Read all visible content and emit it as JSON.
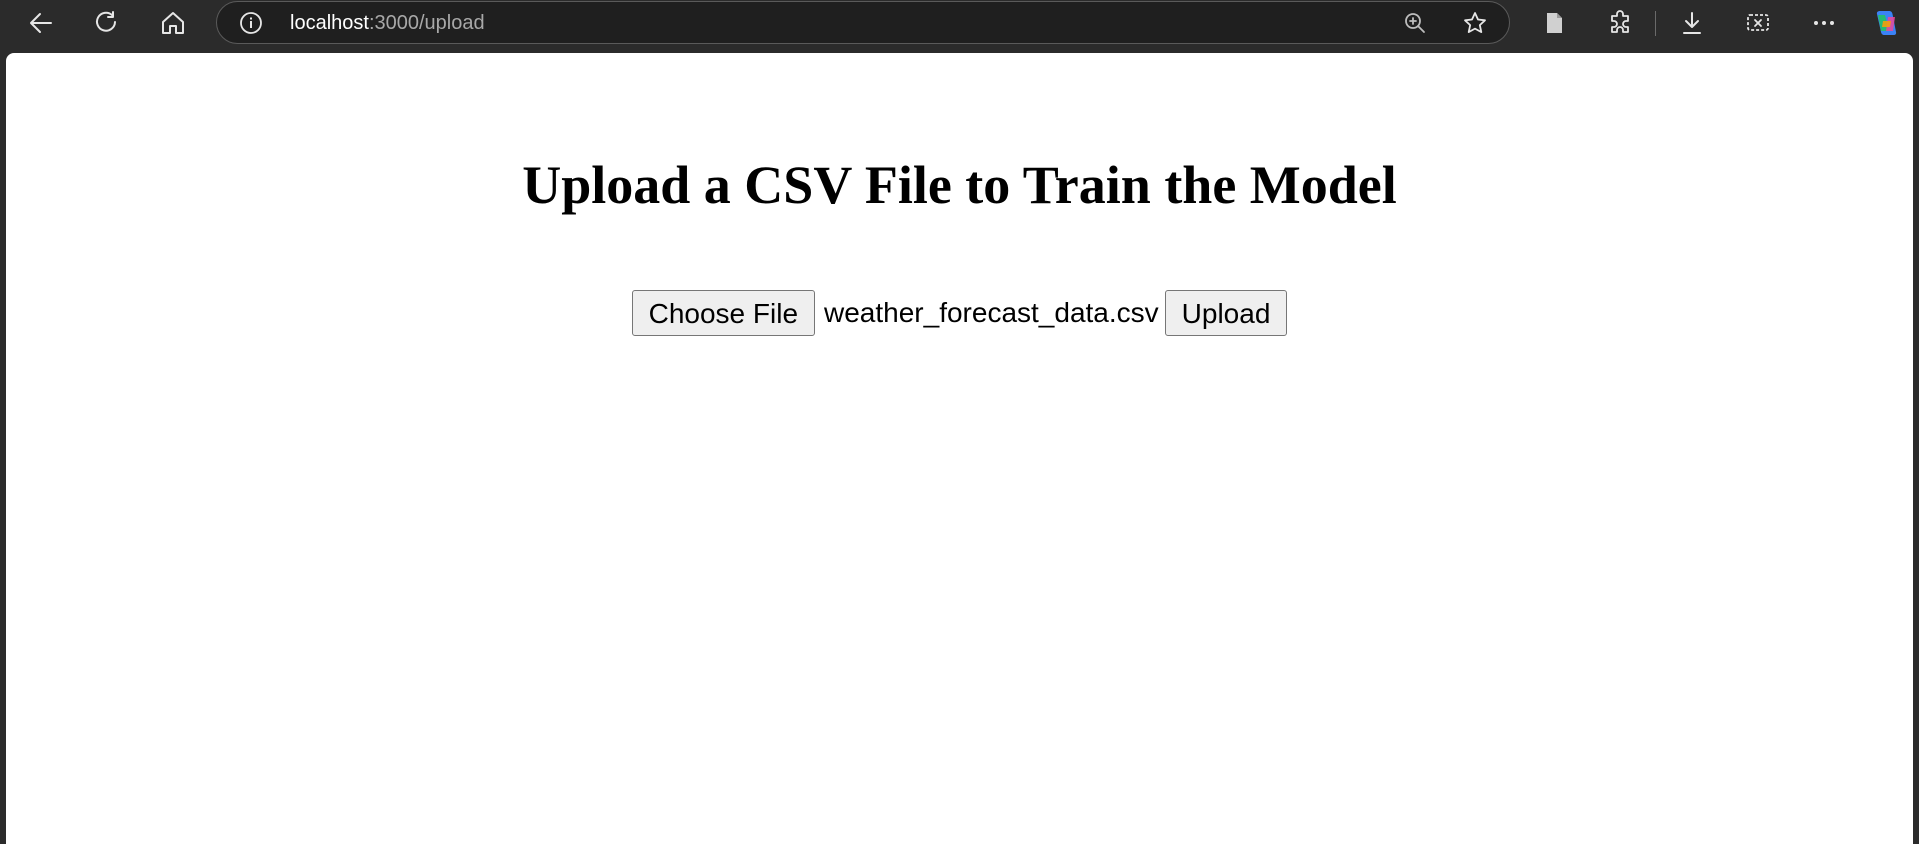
{
  "browser": {
    "url_host": "localhost",
    "url_path": ":3000/upload",
    "nav_icons": [
      "back-icon",
      "refresh-icon",
      "home-icon"
    ],
    "address_icons": [
      "site-info-icon",
      "zoom-icon",
      "favorite-star-icon"
    ],
    "toolbar_icons": [
      "reading-view-icon",
      "extensions-icon",
      "downloads-icon",
      "screenshot-icon",
      "more-options-icon",
      "copilot-icon"
    ]
  },
  "page": {
    "title": "Upload a CSV File to Train the Model",
    "file_input": {
      "button_label": "Choose File",
      "selected_file": "weather_forecast_data.csv"
    },
    "upload_button_label": "Upload"
  },
  "colors": {
    "toolbar_bg": "#2b2b2b",
    "page_bg": "#ffffff",
    "button_bg": "#efefef"
  }
}
